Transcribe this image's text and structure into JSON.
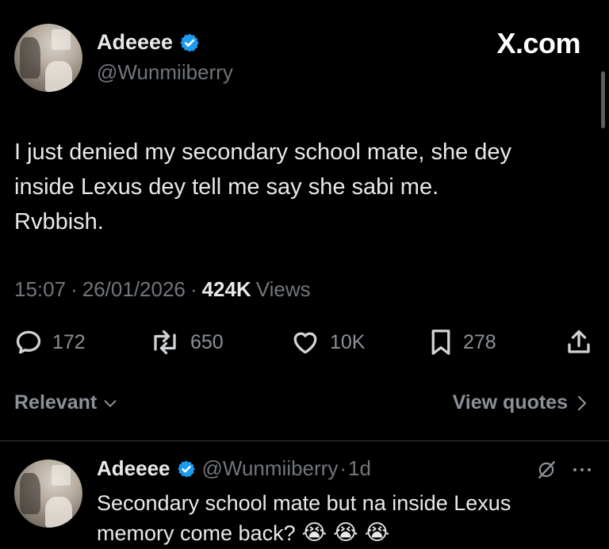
{
  "main_tweet": {
    "author_name": "Adeeee",
    "author_handle": "@Wunmiiberry",
    "source_label": "X.com",
    "text_lines": [
      "I just denied my secondary school mate, she dey",
      "inside Lexus dey tell me say she sabi me.",
      "Rvbbish."
    ],
    "time": "15:07",
    "date": "26/01/2026",
    "views_count": "424K",
    "views_label": "Views",
    "sep": "·",
    "actions": {
      "replies": "172",
      "reposts": "650",
      "likes": "10K",
      "bookmarks": "278"
    }
  },
  "replies_bar": {
    "sort_label": "Relevant",
    "quotes_label": "View quotes"
  },
  "reply": {
    "author_name": "Adeeee",
    "author_handle": "@Wunmiiberry",
    "sep": "·",
    "age": "1d",
    "text_lines": [
      "Secondary school mate but na inside Lexus",
      "memory come back?"
    ],
    "emoji": "😭"
  },
  "colors": {
    "background": "#000000",
    "text": "#e7e9ea",
    "muted": "#71767b",
    "verified": "#1d9bf0"
  }
}
